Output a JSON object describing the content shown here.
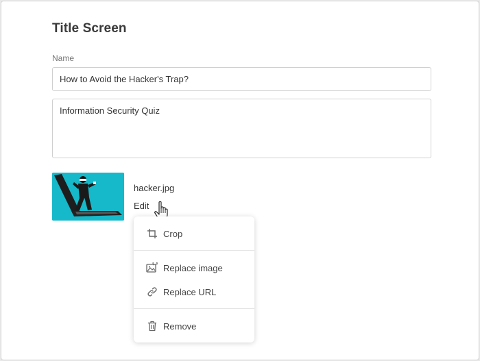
{
  "page": {
    "title": "Title Screen"
  },
  "form": {
    "name_label": "Name",
    "name_value": "How to Avoid the Hacker's Trap?",
    "description_value": "Information Security Quiz"
  },
  "image": {
    "filename": "hacker.jpg",
    "edit_label": "Edit",
    "thumbnail_bg": "#15b9c9"
  },
  "menu": {
    "crop": "Crop",
    "replace_image": "Replace image",
    "replace_url": "Replace URL",
    "remove": "Remove"
  }
}
